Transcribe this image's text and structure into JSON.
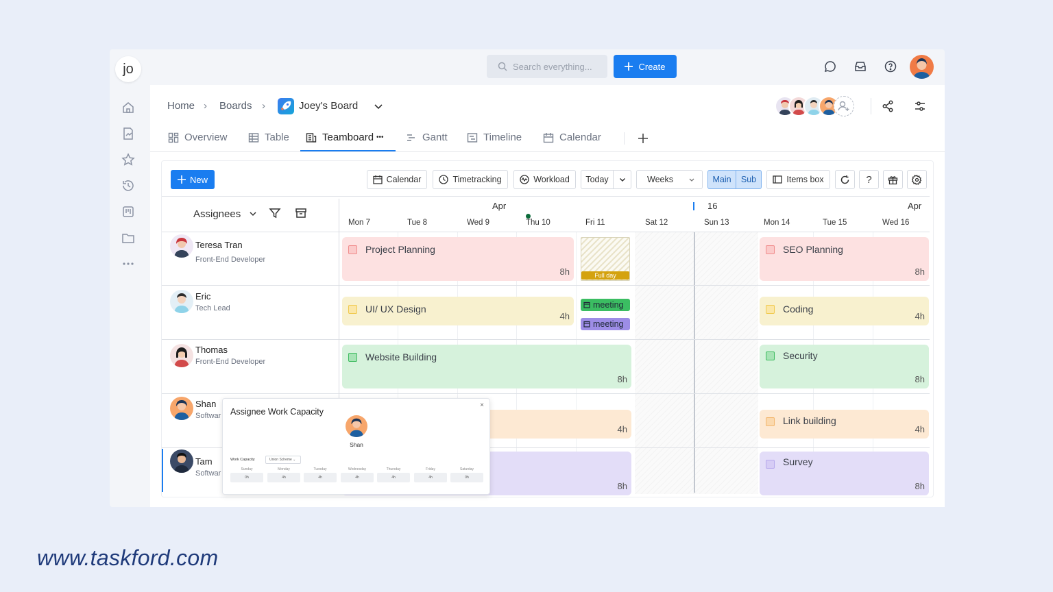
{
  "sidebar": {
    "logo": "jo",
    "icons": [
      "home-icon",
      "report-icon",
      "star-icon",
      "history-icon",
      "board-icon",
      "folder-icon",
      "more-icon"
    ]
  },
  "topbar": {
    "search_placeholder": "Search everything...",
    "create_label": "Create",
    "icons": [
      "chat-icon",
      "inbox-icon",
      "help-icon"
    ]
  },
  "breadcrumb": {
    "home": "Home",
    "boards": "Boards",
    "board_name": "Joey's Board"
  },
  "tabs": [
    {
      "label": "Overview",
      "icon": "overview-icon"
    },
    {
      "label": "Table",
      "icon": "table-icon"
    },
    {
      "label": "Teamboard",
      "icon": "teamboard-icon",
      "active": true,
      "suffix": "•••"
    },
    {
      "label": "Gantt",
      "icon": "gantt-icon"
    },
    {
      "label": "Timeline",
      "icon": "timeline-icon"
    },
    {
      "label": "Calendar",
      "icon": "calendar-icon"
    }
  ],
  "toolbar": {
    "new_label": "New",
    "calendar": "Calendar",
    "timetracking": "Timetracking",
    "workload": "Workload",
    "today": "Today",
    "weeks": "Weeks",
    "main": "Main",
    "sub": "Sub",
    "items_box": "Items box",
    "help": "?"
  },
  "grid": {
    "assignees_label": "Assignees",
    "month_left": "Apr",
    "week_marker": "16",
    "month_right": "Apr",
    "days": [
      {
        "dow": "Mon",
        "num": "7"
      },
      {
        "dow": "Tue",
        "num": "8"
      },
      {
        "dow": "Wed",
        "num": "9"
      },
      {
        "dow": "Thu",
        "num": "10"
      },
      {
        "dow": "Fri",
        "num": "11"
      },
      {
        "dow": "Sat",
        "num": "12"
      },
      {
        "dow": "Sun",
        "num": "13"
      },
      {
        "dow": "Mon",
        "num": "14"
      },
      {
        "dow": "Tue",
        "num": "15"
      },
      {
        "dow": "Wed",
        "num": "16"
      }
    ]
  },
  "people": [
    {
      "name": "Teresa Tran",
      "role": "Front-End Developer"
    },
    {
      "name": "Eric",
      "role": "Tech Lead"
    },
    {
      "name": "Thomas",
      "role": "Front-End Developer"
    },
    {
      "name": "Shan",
      "role": "Softwar"
    },
    {
      "name": "Tam",
      "role": "Softwar"
    }
  ],
  "tasks": {
    "project_planning": {
      "title": "Project Planning",
      "hours": "8h"
    },
    "full_day": "Full day",
    "seo_planning": {
      "title": "SEO Planning",
      "hours": "8h"
    },
    "ui_ux": {
      "title": "UI/ UX Design",
      "hours": "4h"
    },
    "meeting1": "meeting",
    "meeting2": "meeting",
    "coding": {
      "title": "Coding",
      "hours": "4h"
    },
    "website": {
      "title": "Website Building",
      "hours": "8h"
    },
    "security": {
      "title": "Security",
      "hours": "8h"
    },
    "shan_task": {
      "hours": "4h"
    },
    "link_building": {
      "title": "Link building",
      "hours": "4h"
    },
    "tam_task": {
      "hours": "8h"
    },
    "survey": {
      "title": "Survey",
      "hours": "8h"
    }
  },
  "popup": {
    "title": "Assignee Work Capacity",
    "close": "×",
    "person": "Shan",
    "capacity_label": "Work Capacity",
    "scheme": "Union Scheme",
    "days": [
      "Sunday",
      "Monday",
      "Tuesday",
      "Wednesday",
      "Thursday",
      "Friday",
      "Saturday"
    ],
    "values": [
      "0h",
      "4h",
      "4h",
      "4h",
      "4h",
      "4h",
      "0h"
    ]
  },
  "watermark": "www.taskford.com",
  "colors": {
    "accent": "#1a7df0",
    "pink": "#fde1e1",
    "yellow": "#f8f1cf",
    "green": "#d6f2dc",
    "orange": "#fde9d3",
    "purple": "#e3ddf8",
    "meeting_green": "#3bbd62",
    "meeting_purple": "#9d8de6"
  }
}
